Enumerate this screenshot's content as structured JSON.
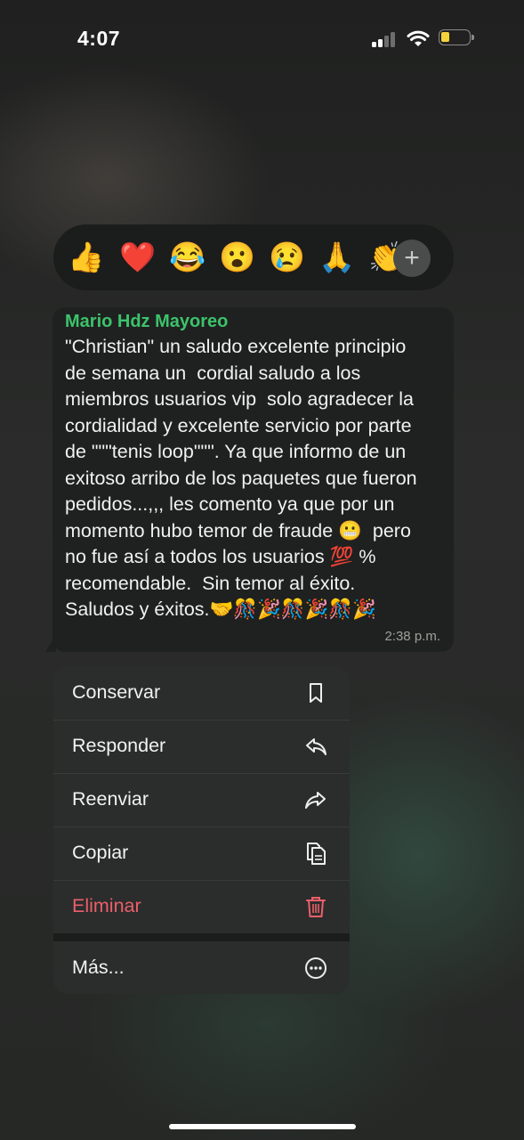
{
  "status_bar": {
    "time": "4:07"
  },
  "reactions": {
    "items": [
      "👍",
      "❤️",
      "😂",
      "😮",
      "😢",
      "🙏",
      "👏"
    ],
    "add_label": "+"
  },
  "message": {
    "sender": "Mario Hdz Mayoreo",
    "text": "\"Christian\" un saludo excelente principio\nde semana un  cordial saludo a los\nmiembros usuarios vip  solo agradecer la\ncordialidad y excelente servicio por parte\nde \"\"\"tenis loop\"\"\". Ya que informo de un\nexitoso arribo de los paquetes que fueron\npedidos...,,, les comento ya que por un\nmomento hubo temor de fraude 😬  pero\nno fue así a todos los usuarios 💯 %\nrecomendable.  Sin temor al éxito.\nSaludos y éxitos.🤝🎊🎉🎊🎉🎊🎉",
    "time": "2:38 p.m."
  },
  "menu": {
    "conservar": "Conservar",
    "responder": "Responder",
    "reenviar": "Reenviar",
    "copiar": "Copiar",
    "eliminar": "Eliminar",
    "mas": "Más..."
  },
  "colors": {
    "sender": "#3cc36b",
    "danger": "#ec5f6a",
    "battery": "#f3d23c"
  }
}
